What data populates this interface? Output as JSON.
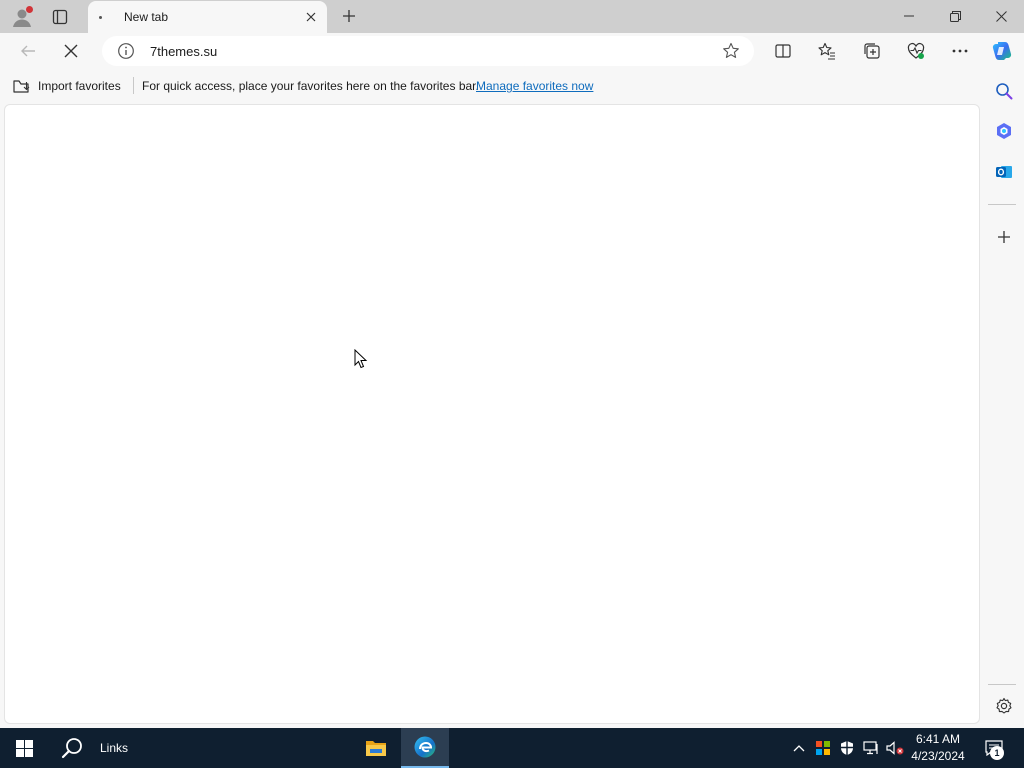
{
  "browser": {
    "tab": {
      "title": "New tab"
    },
    "address_bar": {
      "url": "7themes.su"
    },
    "favorites_bar": {
      "import_label": "Import favorites",
      "message": "For quick access, place your favorites here on the favorites bar.",
      "manage_link": "Manage favorites now"
    }
  },
  "taskbar": {
    "links_label": "Links",
    "clock": {
      "time": "6:41 AM",
      "date": "4/23/2024"
    },
    "notification_count": "1"
  },
  "colors": {
    "accent": "#0f6cbd",
    "taskbar": "#0f1f30",
    "tabstrip": "#cfcfcf",
    "profile_badge": "#d13438"
  }
}
